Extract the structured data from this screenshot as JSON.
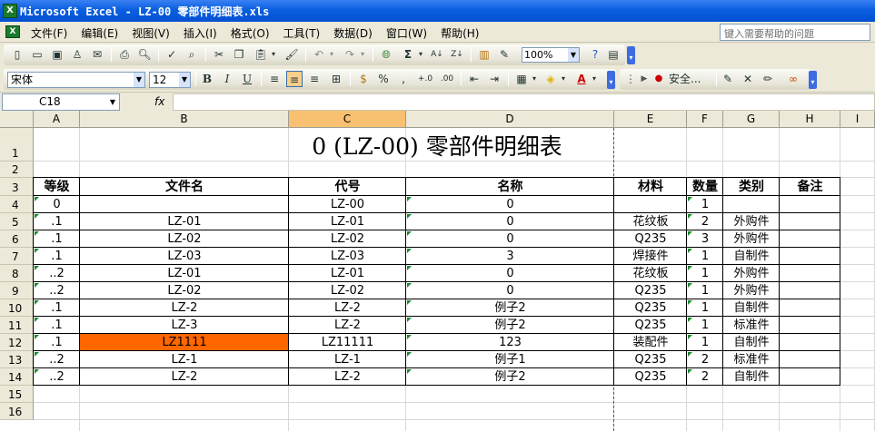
{
  "window": {
    "title": "Microsoft Excel - LZ-00 零部件明细表.xls",
    "app_icon": "excel-icon"
  },
  "menu": {
    "items": [
      "文件(F)",
      "编辑(E)",
      "视图(V)",
      "插入(I)",
      "格式(O)",
      "工具(T)",
      "数据(D)",
      "窗口(W)",
      "帮助(H)"
    ],
    "help_placeholder": "键入需要帮助的问题"
  },
  "toolbar": {
    "zoom": "100%",
    "security_label": "安全..."
  },
  "format_toolbar": {
    "font_name": "宋体",
    "font_size": "12",
    "bold": "B",
    "italic": "I",
    "underline": "U",
    "percent": "%",
    "comma": ","
  },
  "formula_bar": {
    "name_box": "C18",
    "fx_label": "fx",
    "formula": ""
  },
  "columns": [
    "A",
    "B",
    "C",
    "D",
    "E",
    "F",
    "G",
    "H",
    "I"
  ],
  "selected_column": "C",
  "rows": [
    "1",
    "2",
    "3",
    "4",
    "5",
    "6",
    "7",
    "8",
    "9",
    "10",
    "11",
    "12",
    "13",
    "14",
    "15",
    "16"
  ],
  "sheet": {
    "title": "0 (LZ-00) 零部件明细表",
    "headers": [
      "等级",
      "文件名",
      "代号",
      "名称",
      "材料",
      "数量",
      "类别",
      "备注"
    ],
    "data": [
      [
        "0",
        "",
        "LZ-00",
        "0",
        "",
        "1",
        "",
        ""
      ],
      [
        ".1",
        "LZ-01",
        "LZ-01",
        "0",
        "花纹板",
        "2",
        "外购件",
        ""
      ],
      [
        ".1",
        "LZ-02",
        "LZ-02",
        "0",
        "Q235",
        "3",
        "外购件",
        ""
      ],
      [
        ".1",
        "LZ-03",
        "LZ-03",
        "3",
        "焊接件",
        "1",
        "自制件",
        ""
      ],
      [
        "..2",
        "LZ-01",
        "LZ-01",
        "0",
        "花纹板",
        "1",
        "外购件",
        ""
      ],
      [
        "..2",
        "LZ-02",
        "LZ-02",
        "0",
        "Q235",
        "1",
        "外购件",
        ""
      ],
      [
        ".1",
        "LZ-2",
        "LZ-2",
        "例子2",
        "Q235",
        "1",
        "自制件",
        ""
      ],
      [
        ".1",
        "LZ-3",
        "LZ-2",
        "例子2",
        "Q235",
        "1",
        "标准件",
        ""
      ],
      [
        ".1",
        "LZ1111",
        "LZ11111",
        "123",
        "装配件",
        "1",
        "自制件",
        ""
      ],
      [
        "..2",
        "LZ-1",
        "LZ-1",
        "例子1",
        "Q235",
        "2",
        "标准件",
        ""
      ],
      [
        "..2",
        "LZ-2",
        "LZ-2",
        "例子2",
        "Q235",
        "2",
        "自制件",
        ""
      ]
    ],
    "highlight_color": "#ff6600",
    "highlight_cell": "B12"
  }
}
